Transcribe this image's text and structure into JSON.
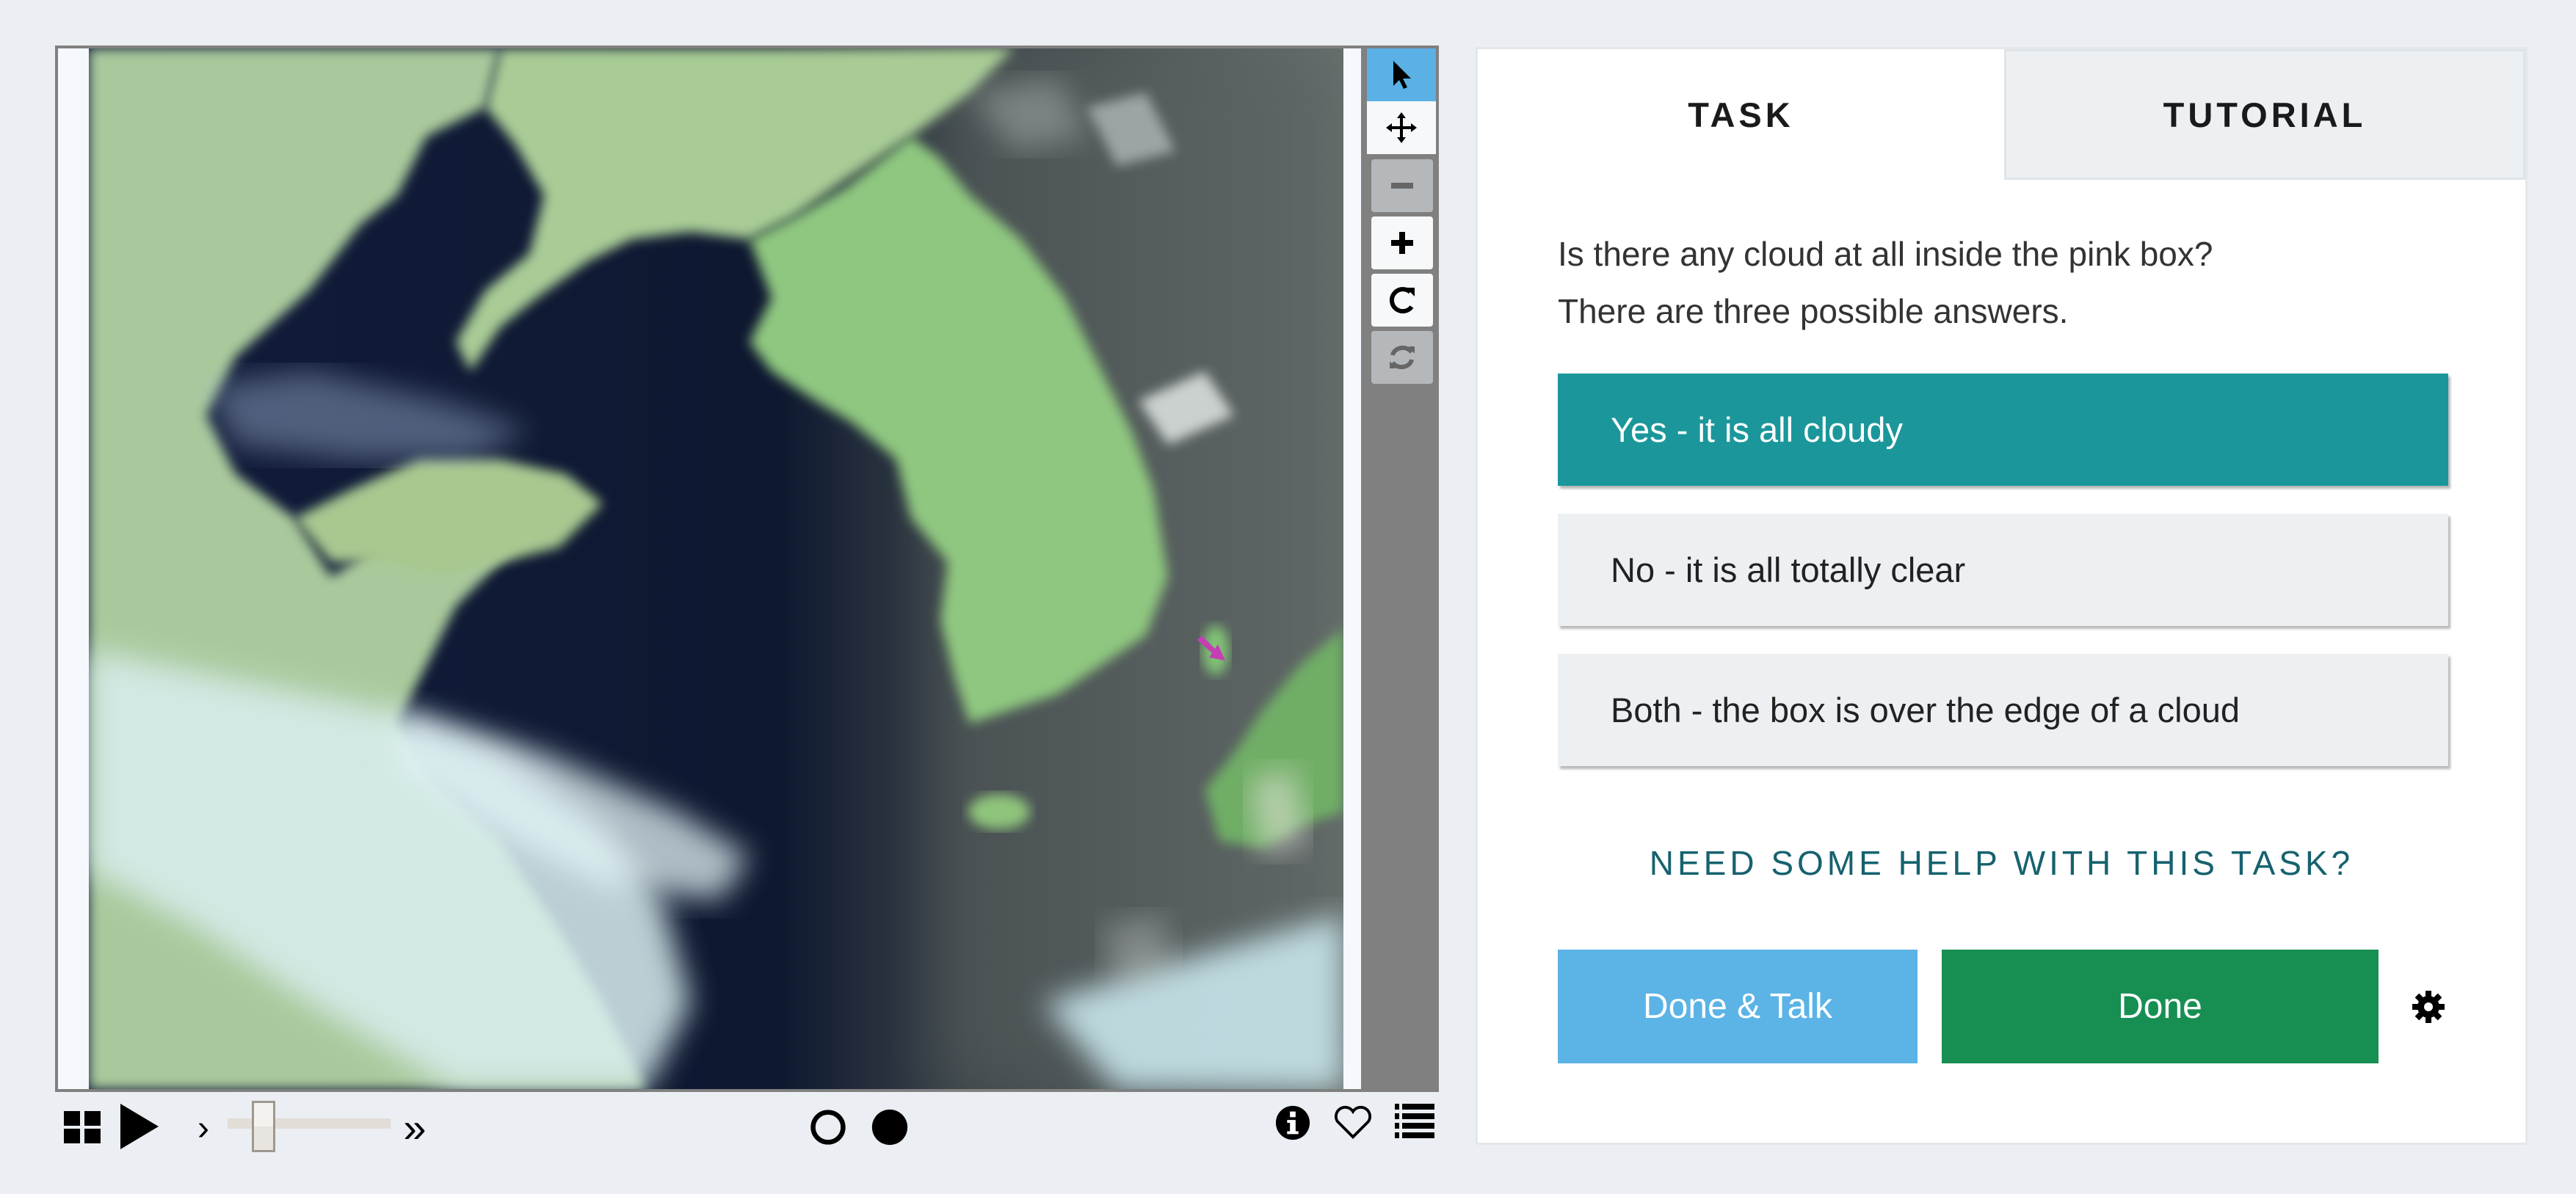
{
  "viewer": {
    "image_description": "satellite imagery of Korean peninsula and Yellow Sea with clouds",
    "marker": {
      "shape": "arrow",
      "direction": "down-right",
      "color": "#c43fb4"
    },
    "toolbar": [
      {
        "name": "pointer",
        "icon": "pointer-arrow-icon",
        "state": "active"
      },
      {
        "name": "pan",
        "icon": "move-arrows-icon",
        "state": "enabled"
      },
      {
        "name": "zoom-out",
        "icon": "minus-icon",
        "state": "disabled"
      },
      {
        "name": "zoom-in",
        "icon": "plus-icon",
        "state": "enabled"
      },
      {
        "name": "rotate",
        "icon": "rotate-icon",
        "state": "enabled"
      },
      {
        "name": "reset",
        "icon": "refresh-icon",
        "state": "disabled"
      }
    ],
    "controls": {
      "grid_icon": "grid-icon",
      "play_icon": "play-icon",
      "step_forward": "›",
      "skip_end": "»",
      "slider_value": 0.15,
      "frames": [
        {
          "state": "empty"
        },
        {
          "state": "filled"
        }
      ],
      "info_icon": "info-icon",
      "favorite_icon": "heart-icon",
      "collections_icon": "list-icon"
    }
  },
  "panel": {
    "tabs": [
      {
        "label": "TASK",
        "active": true
      },
      {
        "label": "TUTORIAL",
        "active": false
      }
    ],
    "question": {
      "line1": "Is there any cloud at all inside the pink box?",
      "line2": "There are three possible answers."
    },
    "answers": [
      {
        "label": "Yes - it is all cloudy",
        "selected": true
      },
      {
        "label": "No - it is all totally clear",
        "selected": false
      },
      {
        "label": "Both - the box is over the edge of a cloud",
        "selected": false
      }
    ],
    "help_link": "NEED SOME HELP WITH THIS TASK?",
    "buttons": {
      "done_talk": "Done & Talk",
      "done": "Done"
    },
    "colors": {
      "selected_answer": "#1b979b",
      "done_talk": "#5bb3e6",
      "done": "#178f53",
      "help_text": "#16626e"
    }
  }
}
